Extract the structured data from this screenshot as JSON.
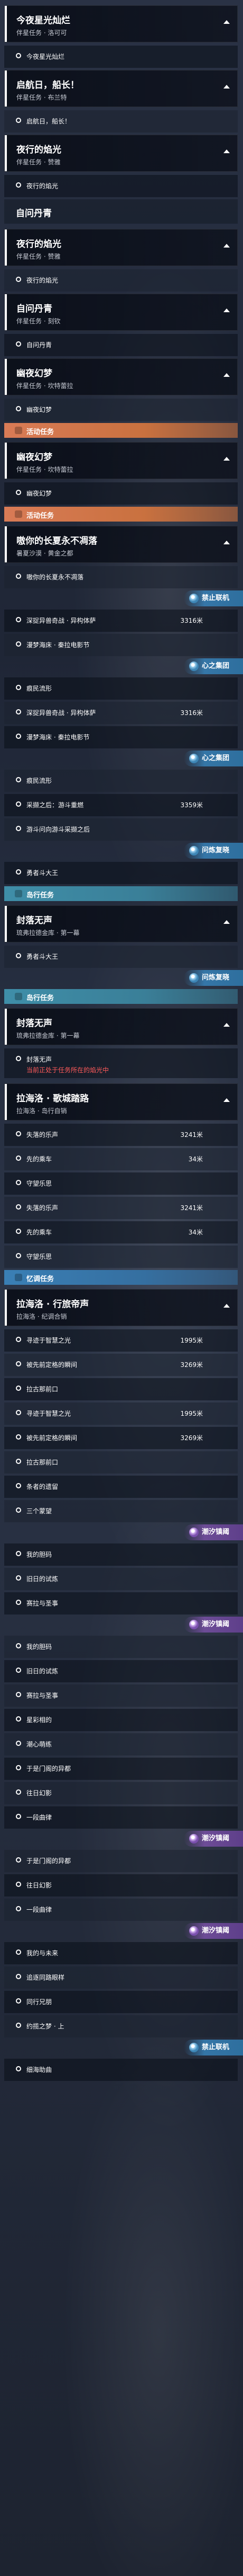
{
  "header_sub_main": "伴星任务 · 赞雅",
  "items": [
    {
      "kind": "hdr",
      "title": "今夜星光灿烂",
      "sub": "伴星任务 · 洛可可"
    },
    {
      "kind": "obj",
      "text": "今夜星光灿烂"
    },
    {
      "kind": "hdr",
      "title": "启航日，船长！",
      "sub": "伴星任务 · 布兰特"
    },
    {
      "kind": "obj",
      "text": "启航日，船长！"
    },
    {
      "kind": "hdr",
      "title": "夜行的焰光",
      "sub": "伴星任务 · 赞雅"
    },
    {
      "kind": "obj",
      "text": "夜行的焰光"
    },
    {
      "kind": "solo",
      "title": "自问丹青"
    },
    {
      "kind": "hdr",
      "title": "夜行的焰光",
      "sub": "伴星任务 · 赞雅"
    },
    {
      "kind": "obj",
      "text": "夜行的焰光"
    },
    {
      "kind": "hdr",
      "title": "自问丹青",
      "sub": "伴星任务 · 刻钦"
    },
    {
      "kind": "obj",
      "text": "自问丹青"
    },
    {
      "kind": "hdr",
      "title": "幽夜幻梦",
      "sub": "伴星任务 · 坎特蕾拉"
    },
    {
      "kind": "obj",
      "text": "幽夜幻梦"
    },
    {
      "kind": "cat",
      "color": "orange",
      "label": "活动任务"
    },
    {
      "kind": "hdr",
      "title": "幽夜幻梦",
      "sub": "伴星任务 · 坎特蕾拉"
    },
    {
      "kind": "obj",
      "text": "幽夜幻梦"
    },
    {
      "kind": "cat",
      "color": "orange",
      "label": "活动任务"
    },
    {
      "kind": "hdr",
      "title": "嗷你的长夏永不凋落",
      "sub": "暑夏沙漠 · 黄金之都"
    },
    {
      "kind": "obj",
      "text": "嗷你的长夏永不凋落"
    },
    {
      "kind": "badge",
      "color": "blue",
      "text": "禁止联机"
    },
    {
      "kind": "obj",
      "text": "深捉异兽奇战 · 异构体萨",
      "dist": "3316米"
    },
    {
      "kind": "obj",
      "text": "漫梦海床 · 秦拉电影节"
    },
    {
      "kind": "badge",
      "color": "blue",
      "text": "心之集团"
    },
    {
      "kind": "obj",
      "text": "痕民流形"
    },
    {
      "kind": "obj",
      "text": "深捉异兽奇战 · 异构体萨",
      "dist": "3316米"
    },
    {
      "kind": "obj",
      "text": "漫梦海床 · 秦拉电影节"
    },
    {
      "kind": "badge",
      "color": "blue",
      "text": "心之集团"
    },
    {
      "kind": "obj",
      "text": "痕民流形"
    },
    {
      "kind": "obj",
      "text": "采撷之后：游斗重燃",
      "dist": "3359米"
    },
    {
      "kind": "obj",
      "text": "游斗问向游斗采撷之后"
    },
    {
      "kind": "badge",
      "color": "blue",
      "text": "问炼复晓"
    },
    {
      "kind": "obj",
      "text": "勇者斗大王"
    },
    {
      "kind": "cat",
      "color": "teal",
      "label": "岛行任务"
    },
    {
      "kind": "hdr",
      "title": "封落无声",
      "sub": "琉弗拉德金库 · 第一幕"
    },
    {
      "kind": "obj",
      "text": "勇者斗大王"
    },
    {
      "kind": "badge",
      "color": "blue",
      "text": "问炼复晓"
    },
    {
      "kind": "cat",
      "color": "teal",
      "label": "岛行任务"
    },
    {
      "kind": "hdr",
      "title": "封落无声",
      "sub": "琉弗拉德金库 · 第一幕"
    },
    {
      "kind": "warn",
      "text": "封落无声",
      "warn": "当前正处于任务所在的焰光中"
    },
    {
      "kind": "hdr",
      "title": "拉海洛 · 歌城踏路",
      "sub": "拉海洛 · 岛行自销"
    },
    {
      "kind": "obj",
      "text": "失落的乐声",
      "dist": "3241米"
    },
    {
      "kind": "obj",
      "text": "先的乘车",
      "dist": "34米"
    },
    {
      "kind": "obj",
      "text": "守望乐思"
    },
    {
      "kind": "obj",
      "text": "失落的乐声",
      "dist": "3241米"
    },
    {
      "kind": "obj",
      "text": "先的乘车",
      "dist": "34米"
    },
    {
      "kind": "obj",
      "text": "守望乐思"
    },
    {
      "kind": "cat",
      "color": "blue",
      "label": "忆调任务"
    },
    {
      "kind": "hdr",
      "title": "拉海洛 · 行旅帝声",
      "sub": "拉海洛 · 纪调合销"
    },
    {
      "kind": "obj",
      "text": "寻迹于智慧之光",
      "dist": "1995米"
    },
    {
      "kind": "obj",
      "text": "被先前定格的瞬间",
      "dist": "3269米"
    },
    {
      "kind": "obj",
      "text": "拉古那前口"
    },
    {
      "kind": "obj",
      "text": "寻迹于智慧之光",
      "dist": "1995米"
    },
    {
      "kind": "obj",
      "text": "被先前定格的瞬间",
      "dist": "3269米"
    },
    {
      "kind": "obj",
      "text": "拉古那前口"
    },
    {
      "kind": "obj",
      "text": "条者的遗留"
    },
    {
      "kind": "obj",
      "text": "三个蒙望"
    },
    {
      "kind": "badge",
      "color": "purple",
      "text": "潮汐镇阈"
    },
    {
      "kind": "obj",
      "text": "我的胆码"
    },
    {
      "kind": "obj",
      "text": "旧日的试炼"
    },
    {
      "kind": "obj",
      "text": "赛拉与圣事"
    },
    {
      "kind": "badge",
      "color": "purple",
      "text": "潮汐镇阈"
    },
    {
      "kind": "obj",
      "text": "我的胆码"
    },
    {
      "kind": "obj",
      "text": "旧日的试炼"
    },
    {
      "kind": "obj",
      "text": "赛拉与圣事"
    },
    {
      "kind": "obj",
      "text": "星彩相的"
    },
    {
      "kind": "obj",
      "text": "潮心萌练"
    },
    {
      "kind": "obj",
      "text": "于是门阁的异都"
    },
    {
      "kind": "obj",
      "text": "往日幻影"
    },
    {
      "kind": "obj",
      "text": "一段曲律"
    },
    {
      "kind": "badge",
      "color": "purple",
      "text": "潮汐镇阈"
    },
    {
      "kind": "obj",
      "text": "于是门阁的异都"
    },
    {
      "kind": "obj",
      "text": "往日幻影"
    },
    {
      "kind": "obj",
      "text": "一段曲律"
    },
    {
      "kind": "badge",
      "color": "purple",
      "text": "潮汐镇阈"
    },
    {
      "kind": "obj",
      "text": "我的与未来"
    },
    {
      "kind": "obj",
      "text": "追逐同路眼样"
    },
    {
      "kind": "obj",
      "text": "同行兄朋"
    },
    {
      "kind": "obj",
      "text": "约揽之梦 · 上"
    },
    {
      "kind": "badge",
      "color": "blue",
      "text": "禁止联机"
    },
    {
      "kind": "obj",
      "text": "细海助曲"
    }
  ]
}
